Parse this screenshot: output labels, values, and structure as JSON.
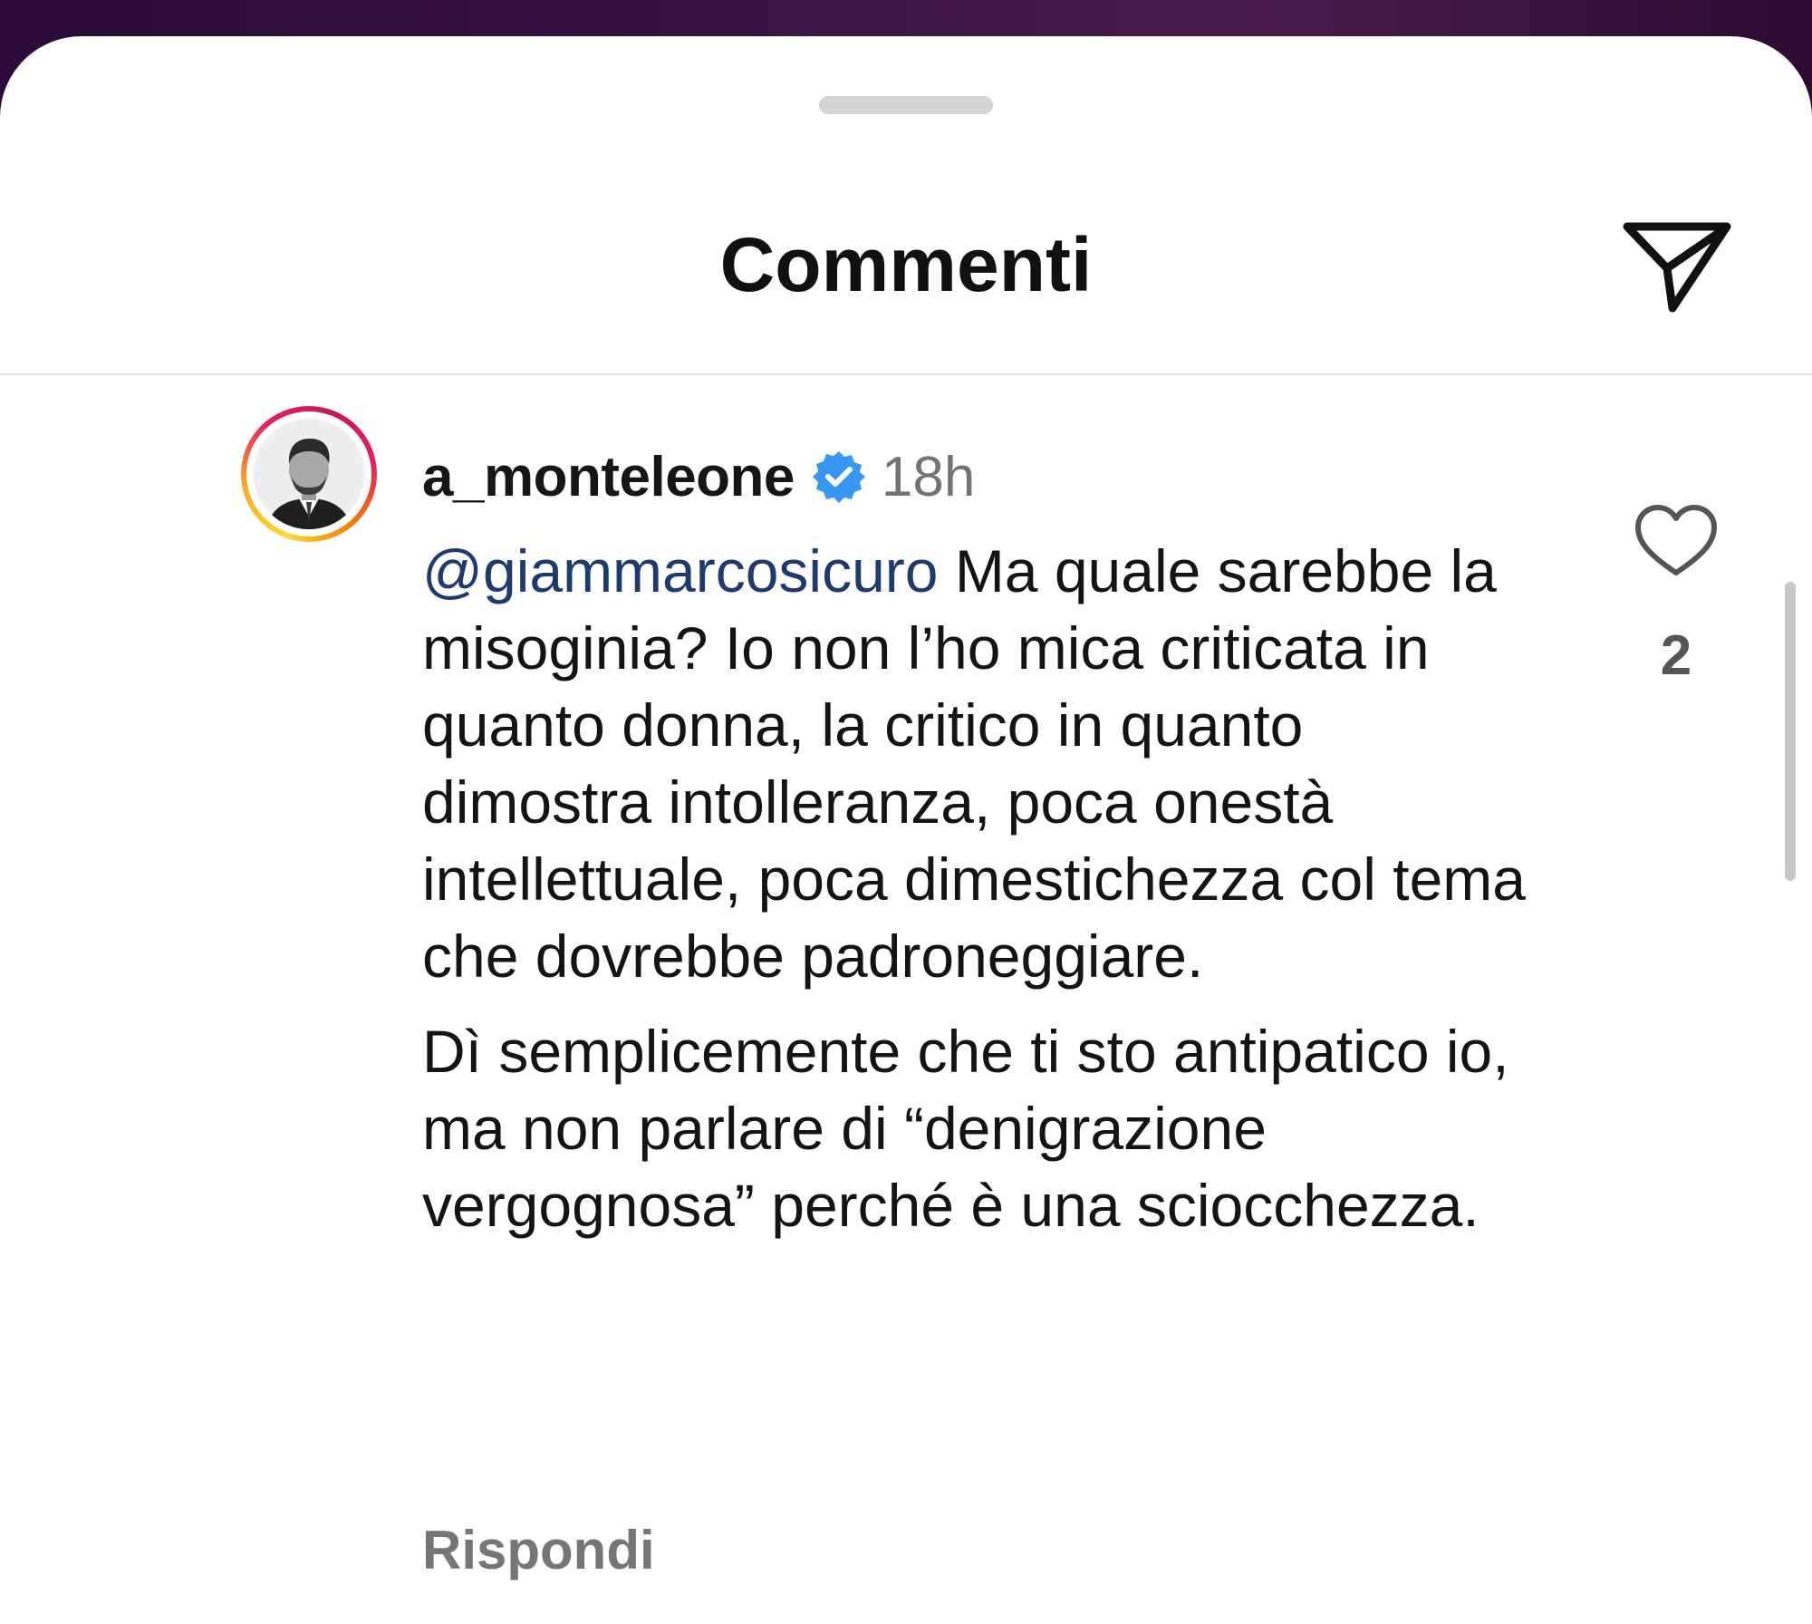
{
  "sheet": {
    "title": "Commenti",
    "send_icon": "paper-plane-icon"
  },
  "comment": {
    "username": "a_monteleone",
    "verified_icon": "verified-badge-icon",
    "verified_color": "#3897f0",
    "timestamp": "18h",
    "mention": "@giammarcosicuro",
    "paragraph1_text": " Ma quale sarebbe la misoginia? Io non l’ho mica criticata in quanto donna, la critico in quanto dimostra intolleranza, poca onestà intellettuale, poca dimestichezza col tema che dovrebbe padroneggiare.",
    "paragraph2_text": "Dì semplicemente che ti sto antipatico io, ma non parlare di “denigrazione vergognosa” perché è una sciocchezza.",
    "reply_label": "Rispondi",
    "like_icon": "heart-icon",
    "like_count": "2"
  }
}
